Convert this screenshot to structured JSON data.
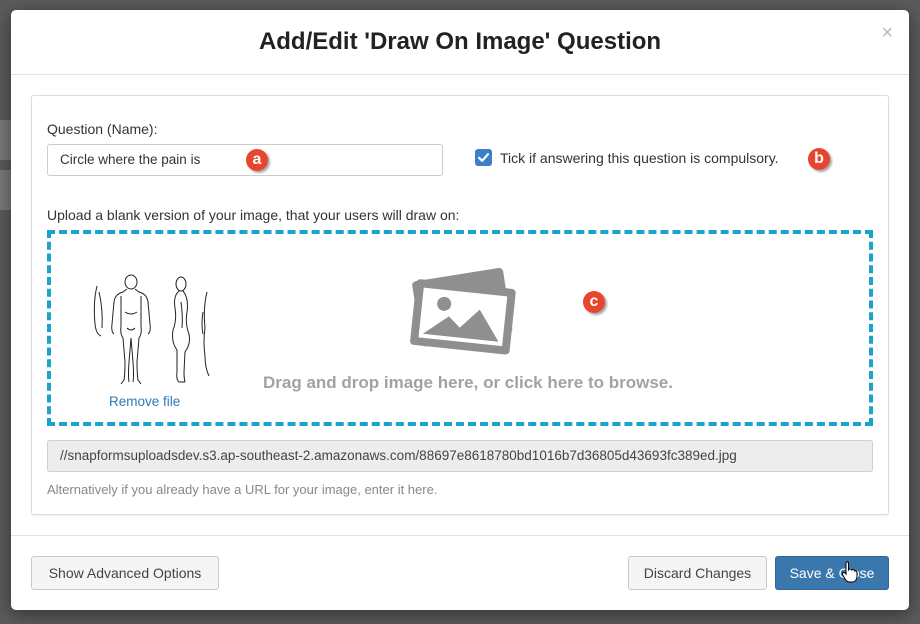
{
  "dialog": {
    "title": "Add/Edit 'Draw On Image' Question",
    "close_glyph": "×"
  },
  "question": {
    "label": "Question (Name):",
    "value": "Circle where the pain is"
  },
  "compulsory": {
    "checked": true,
    "label": "Tick if answering this question is compulsory."
  },
  "upload": {
    "label": "Upload a blank version of your image, that your users will draw on:",
    "drop_text": "Drag and drop image here, or click here to browse.",
    "remove_label": "Remove file",
    "thumbnail_icon": "body-diagram-thumbnail",
    "upload_icon": "image-icon"
  },
  "url": {
    "value": "//snapformsuploadsdev.s3.ap-southeast-2.amazonaws.com/88697e8618780bd1016b7d36805d43693fc389ed.jpg",
    "help": "Alternatively if you already have a URL for your image, enter it here."
  },
  "annotations": {
    "a": "a",
    "b": "b",
    "c": "c",
    "color": "#e8452f"
  },
  "footer": {
    "advanced_label": "Show Advanced Options",
    "discard_label": "Discard Changes",
    "save_label": "Save & Close"
  },
  "colors": {
    "primary": "#3a77ac",
    "dropzone_border": "#1aa4c9",
    "checkbox": "#3c7fc9",
    "link": "#2f78b7"
  }
}
